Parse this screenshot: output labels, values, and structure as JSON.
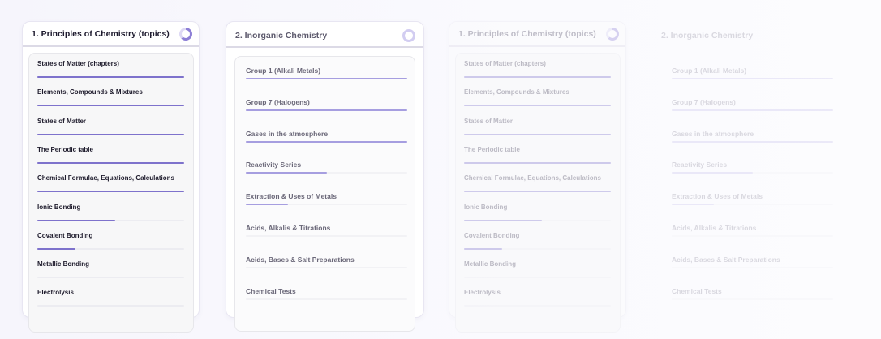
{
  "cards": [
    {
      "title": "1. Principles of Chemistry (topics)",
      "progress_ring": 0.62,
      "items": [
        {
          "label": "States of Matter (chapters)",
          "progress": 1.0
        },
        {
          "label": "Elements, Compounds & Mixtures",
          "progress": 1.0
        },
        {
          "label": "States of Matter",
          "progress": 1.0
        },
        {
          "label": "The Periodic table",
          "progress": 1.0
        },
        {
          "label": "Chemical Formulae, Equations, Calculations",
          "progress": 1.0
        },
        {
          "label": "Ionic Bonding",
          "progress": 0.53
        },
        {
          "label": "Covalent Bonding",
          "progress": 0.26
        },
        {
          "label": "Metallic Bonding",
          "progress": 0
        },
        {
          "label": "Electrolysis",
          "progress": 0
        }
      ]
    },
    {
      "title": "2. Inorganic Chemistry",
      "progress_ring": 0,
      "items": [
        {
          "label": "Group 1 (Alkali Metals)",
          "progress": 1.0
        },
        {
          "label": "Group 7 (Halogens)",
          "progress": 1.0
        },
        {
          "label": "Gases in the atmosphere",
          "progress": 1.0
        },
        {
          "label": "Reactivity Series",
          "progress": 0.5
        },
        {
          "label": "Extraction & Uses of Metals",
          "progress": 0.26
        },
        {
          "label": "Acids, Alkalis & Titrations",
          "progress": 0
        },
        {
          "label": "Acids, Bases & Salt Preparations",
          "progress": 0
        },
        {
          "label": "Chemical Tests",
          "progress": 0
        }
      ]
    },
    {
      "title": "1. Principles of Chemistry (topics)",
      "progress_ring": 0.62,
      "items": [
        {
          "label": "States of Matter (chapters)",
          "progress": 1.0
        },
        {
          "label": "Elements, Compounds & Mixtures",
          "progress": 1.0
        },
        {
          "label": "States of Matter",
          "progress": 1.0
        },
        {
          "label": "The Periodic table",
          "progress": 1.0
        },
        {
          "label": "Chemical Formulae, Equations, Calculations",
          "progress": 1.0
        },
        {
          "label": "Ionic Bonding",
          "progress": 0.53
        },
        {
          "label": "Covalent Bonding",
          "progress": 0.26
        },
        {
          "label": "Metallic Bonding",
          "progress": 0
        },
        {
          "label": "Electrolysis",
          "progress": 0
        }
      ]
    },
    {
      "title": "2. Inorganic Chemistry",
      "items": [
        {
          "label": "Group 1 (Alkali Metals)",
          "progress": 1.0
        },
        {
          "label": "Group 7 (Halogens)",
          "progress": 1.0
        },
        {
          "label": "Gases in the atmosphere",
          "progress": 1.0
        },
        {
          "label": "Reactivity Series",
          "progress": 0.5
        },
        {
          "label": "Extraction & Uses of Metals",
          "progress": 0.26
        },
        {
          "label": "Acids, Alkalis & Titrations",
          "progress": 0
        },
        {
          "label": "Acids, Bases & Salt Preparations",
          "progress": 0
        },
        {
          "label": "Chemical Tests",
          "progress": 0
        }
      ]
    }
  ],
  "colors": {
    "accent": "#7e72cc",
    "accent_light": "#a69ee0",
    "background": "#f6f5fc"
  }
}
